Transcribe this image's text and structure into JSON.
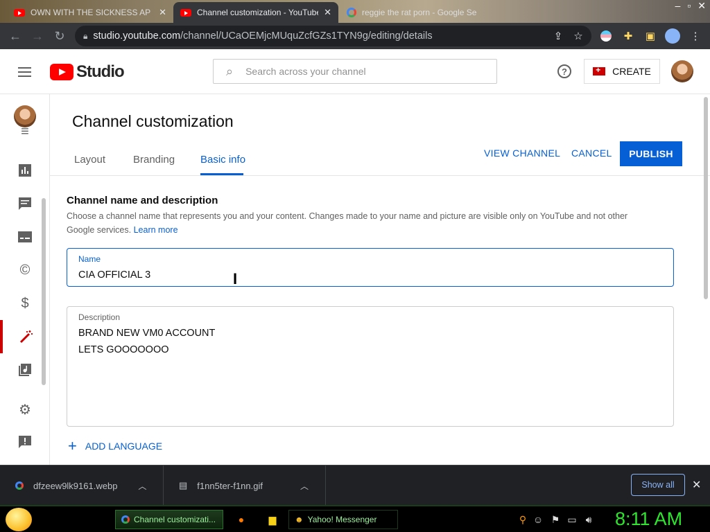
{
  "browser": {
    "tabs": [
      {
        "title": "OWN WITH THE SICKNESS AP",
        "active": false
      },
      {
        "title": "Channel customization - YouTube",
        "active": true
      },
      {
        "title": "reggie the rat porn - Google Se",
        "active": false
      }
    ],
    "url_host": "studio.youtube.com",
    "url_path": "/channel/UCaOEMjcMUquZcfGZs1TYN9g/editing/details"
  },
  "header": {
    "logo_text": "Studio",
    "search_placeholder": "Search across your channel",
    "help_glyph": "?",
    "create_label": "CREATE"
  },
  "page": {
    "title": "Channel customization",
    "tabs": [
      {
        "label": "Layout"
      },
      {
        "label": "Branding"
      },
      {
        "label": "Basic info",
        "active": true
      }
    ],
    "view_channel": "VIEW CHANNEL",
    "cancel": "CANCEL",
    "publish": "PUBLISH"
  },
  "section": {
    "title": "Channel name and description",
    "description": "Choose a channel name that represents you and your content. Changes made to your name and picture are visible only on YouTube and not other Google services.",
    "learn_more": "Learn more",
    "name_label": "Name",
    "name_value": "CIA OFFICIAL 3",
    "description_label": "Description",
    "description_line1": "BRAND NEW VM0 ACCOUNT",
    "description_line2": "LETS GOOOOOOO",
    "add_language": "ADD LANGUAGE"
  },
  "downloads": {
    "items": [
      {
        "filename": "dfzeew9lk9161.webp"
      },
      {
        "filename": "f1nn5ter-f1nn.gif"
      }
    ],
    "show_all": "Show all"
  },
  "taskbar": {
    "tasks": [
      {
        "label": "Channel customizati..."
      },
      {
        "label": "Yahoo! Messenger"
      }
    ],
    "clock": "8:11 AM"
  },
  "colors": {
    "accent": "#065fd4",
    "youtube_red": "#ff0000",
    "clock_green": "#2ee62e"
  }
}
